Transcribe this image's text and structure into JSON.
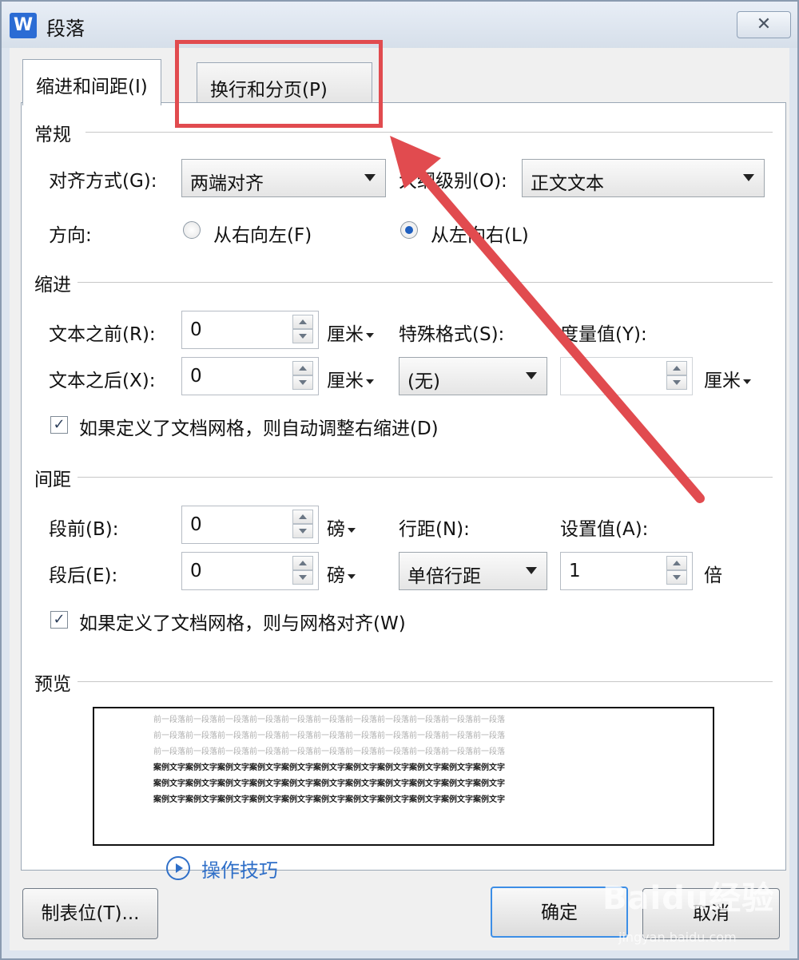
{
  "window": {
    "title": "段落",
    "app_icon_letter": "W",
    "close_label": "✕"
  },
  "tabs": [
    {
      "label": "缩进和间距(I)"
    },
    {
      "label": "换行和分页(P)"
    }
  ],
  "general": {
    "title": "常规",
    "align_label": "对齐方式(G):",
    "align_value": "两端对齐",
    "outline_label": "大纲级别(O):",
    "outline_value": "正文文本",
    "direction_label": "方向:",
    "rtl_label": "从右向左(F)",
    "ltr_label": "从左向右(L)",
    "direction_selected": "ltr"
  },
  "indent": {
    "title": "缩进",
    "before_label": "文本之前(R):",
    "before_value": "0",
    "before_unit": "厘米",
    "after_label": "文本之后(X):",
    "after_value": "0",
    "after_unit": "厘米",
    "special_label": "特殊格式(S):",
    "special_value": "(无)",
    "measure_label": "度量值(Y):",
    "measure_value": "",
    "measure_unit": "厘米",
    "auto_adjust_label": "如果定义了文档网格，则自动调整右缩进(D)",
    "auto_adjust_checked": true
  },
  "spacing": {
    "title": "间距",
    "before_label": "段前(B):",
    "before_value": "0",
    "before_unit": "磅",
    "after_label": "段后(E):",
    "after_value": "0",
    "after_unit": "磅",
    "line_label": "行距(N):",
    "line_value": "单倍行距",
    "setting_label": "设置值(A):",
    "setting_value": "1",
    "setting_unit": "倍",
    "snap_grid_label": "如果定义了文档网格，则与网格对齐(W)",
    "snap_grid_checked": true
  },
  "preview": {
    "title": "预览",
    "prev_line": "前一段落前一段落前一段落前一段落前一段落前一段落前一段落前一段落前一段落前一段落前一段落",
    "sample_line": "案例文字案例文字案例文字案例文字案例文字案例文字案例文字案例文字案例文字案例文字案例文字"
  },
  "footer": {
    "tabs_button": "制表位(T)...",
    "tips_link": "操作技巧",
    "ok_button": "确定",
    "cancel_button": "取消"
  },
  "watermark": {
    "brand": "Baidu经验",
    "url": "jingyan.baidu.com"
  },
  "colors": {
    "annotation": "#e14b4f",
    "link": "#2f6fc8"
  }
}
